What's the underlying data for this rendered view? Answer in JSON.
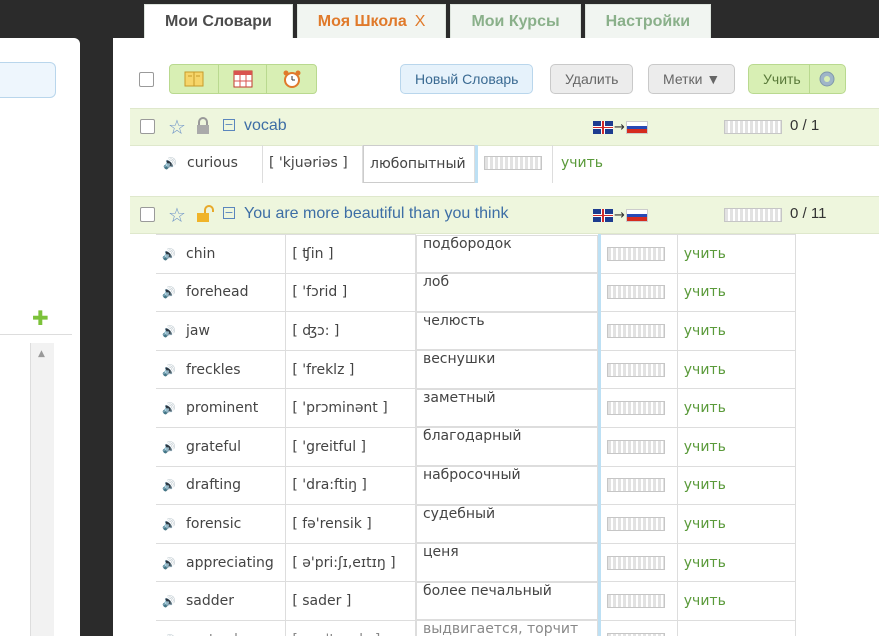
{
  "tabs": [
    {
      "label": "Мои Словари",
      "active": true
    },
    {
      "label": "Моя Школа",
      "close": "X"
    },
    {
      "label": "Мои Курсы"
    },
    {
      "label": "Настройки"
    }
  ],
  "toolbar": {
    "new_dict": "Новый Словарь",
    "delete": "Удалить",
    "tags": "Метки ▼",
    "learn": "Учить"
  },
  "dicts": [
    {
      "name": "vocab",
      "count": "0 / 1",
      "lang_from": "en",
      "lang_to": "ru",
      "locked": true
    },
    {
      "name": "You are more beautiful than you think",
      "count": "0 / 11",
      "lang_from": "en",
      "lang_to": "ru",
      "locked": false
    }
  ],
  "vocab_words": [
    {
      "en": "curious",
      "tr": "[ 'kjuəriəs ]",
      "ru": "любопытный",
      "learn": "учить"
    }
  ],
  "words": [
    {
      "en": "chin",
      "tr": "[ ʧin ]",
      "ru": "подбородок",
      "learn": "учить"
    },
    {
      "en": "forehead",
      "tr": "[ 'fɔrid ]",
      "ru": "лоб",
      "learn": "учить"
    },
    {
      "en": "jaw",
      "tr": "[ ʤɔ: ]",
      "ru": "челюсть",
      "learn": "учить"
    },
    {
      "en": "freckles",
      "tr": "[ 'freklz ]",
      "ru": "веснушки",
      "learn": "учить"
    },
    {
      "en": "prominent",
      "tr": "[ 'prɔminənt ]",
      "ru": "заметный",
      "learn": "учить"
    },
    {
      "en": "grateful",
      "tr": "[ 'greitful ]",
      "ru": "благодарный",
      "learn": "учить"
    },
    {
      "en": "drafting",
      "tr": "[ 'dra:ftiŋ ]",
      "ru": "набросочный",
      "learn": "учить"
    },
    {
      "en": "forensic",
      "tr": "[ fə'rensik ]",
      "ru": "судебный",
      "learn": "учить"
    },
    {
      "en": "appreciating",
      "tr": "[ ə'pri:ʃɪ,eɪtɪŋ ]",
      "ru": "ценя",
      "learn": "учить"
    },
    {
      "en": "sadder",
      "tr": "[ sader ]",
      "ru": "более печальный",
      "learn": "учить"
    },
    {
      "en": "protrudes",
      "tr": "[ prə'tru:dz ]",
      "ru": "выдвигается, торчит",
      "learn": "учить"
    }
  ]
}
